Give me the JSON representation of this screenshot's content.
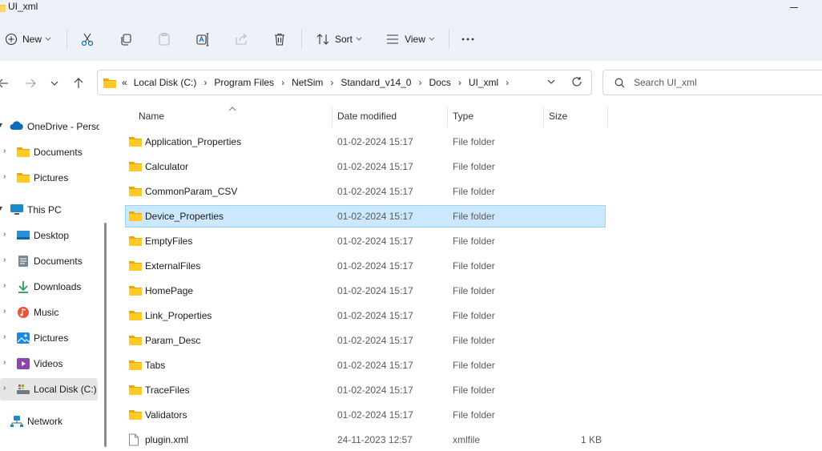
{
  "window": {
    "title": "UI_xml"
  },
  "toolbar": {
    "new_label": "New",
    "sort_label": "Sort",
    "view_label": "View"
  },
  "address": {
    "crumbs": [
      "Local Disk (C:)",
      "Program Files",
      "NetSim",
      "Standard_v14_0",
      "Docs",
      "UI_xml"
    ],
    "overflow": "«"
  },
  "search": {
    "placeholder": "Search UI_xml"
  },
  "sidebar": {
    "items": [
      {
        "label": "OneDrive - Perso",
        "icon": "cloud-icon"
      },
      {
        "label": "Documents",
        "icon": "folder-icon"
      },
      {
        "label": "Pictures",
        "icon": "folder-icon"
      },
      {
        "label": "This PC",
        "icon": "monitor-icon"
      },
      {
        "label": "Desktop",
        "icon": "desktop-icon"
      },
      {
        "label": "Documents",
        "icon": "documents-icon"
      },
      {
        "label": "Downloads",
        "icon": "download-icon"
      },
      {
        "label": "Music",
        "icon": "music-icon"
      },
      {
        "label": "Pictures",
        "icon": "pictures-icon"
      },
      {
        "label": "Videos",
        "icon": "videos-icon"
      },
      {
        "label": "Local Disk (C:)",
        "icon": "drive-icon"
      },
      {
        "label": "Network",
        "icon": "network-icon"
      }
    ]
  },
  "columns": {
    "name": "Name",
    "date": "Date modified",
    "type": "Type",
    "size": "Size"
  },
  "files": [
    {
      "name": "Application_Properties",
      "date": "01-02-2024 15:17",
      "type": "File folder",
      "size": ""
    },
    {
      "name": "Calculator",
      "date": "01-02-2024 15:17",
      "type": "File folder",
      "size": ""
    },
    {
      "name": "CommonParam_CSV",
      "date": "01-02-2024 15:17",
      "type": "File folder",
      "size": ""
    },
    {
      "name": "Device_Properties",
      "date": "01-02-2024 15:17",
      "type": "File folder",
      "size": ""
    },
    {
      "name": "EmptyFiles",
      "date": "01-02-2024 15:17",
      "type": "File folder",
      "size": ""
    },
    {
      "name": "ExternalFiles",
      "date": "01-02-2024 15:17",
      "type": "File folder",
      "size": ""
    },
    {
      "name": "HomePage",
      "date": "01-02-2024 15:17",
      "type": "File folder",
      "size": ""
    },
    {
      "name": "Link_Properties",
      "date": "01-02-2024 15:17",
      "type": "File folder",
      "size": ""
    },
    {
      "name": "Param_Desc",
      "date": "01-02-2024 15:17",
      "type": "File folder",
      "size": ""
    },
    {
      "name": "Tabs",
      "date": "01-02-2024 15:17",
      "type": "File folder",
      "size": ""
    },
    {
      "name": "TraceFiles",
      "date": "01-02-2024 15:17",
      "type": "File folder",
      "size": ""
    },
    {
      "name": "Validators",
      "date": "01-02-2024 15:17",
      "type": "File folder",
      "size": ""
    },
    {
      "name": "plugin.xml",
      "date": "24-11-2023 12:57",
      "type": "xmlfile",
      "size": "1 KB"
    }
  ],
  "selected_file": "Device_Properties",
  "colors": {
    "folder": "#ffca28",
    "selection": "#cce8ff",
    "chrome": "#eef2f8",
    "accent": "#0f6cbd"
  }
}
